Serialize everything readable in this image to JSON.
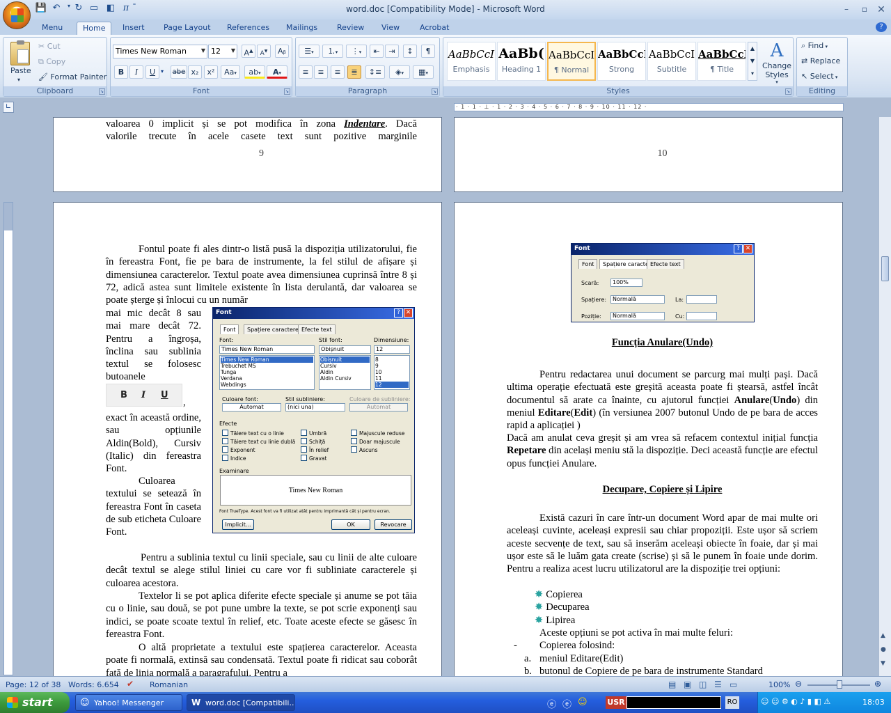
{
  "window": {
    "title": "word.doc [Compatibility Mode] - Microsoft Word"
  },
  "qat": [
    "save-icon",
    "undo-icon",
    "redo-icon",
    "repeat-icon",
    "format-painter-icon",
    "pi-icon",
    "customize-icon"
  ],
  "tabs": [
    "Menu",
    "Home",
    "Insert",
    "Page Layout",
    "References",
    "Mailings",
    "Review",
    "View",
    "Acrobat"
  ],
  "active_tab": "Home",
  "ribbon": {
    "clipboard": {
      "label": "Clipboard",
      "paste": "Paste",
      "cut": "Cut",
      "copy": "Copy",
      "format_painter": "Format Painter"
    },
    "font": {
      "label": "Font",
      "name": "Times New Roman",
      "size": "12",
      "bold": "B",
      "italic": "I",
      "underline": "U",
      "strike": "abe",
      "sub": "x₂",
      "sup": "x²",
      "case": "Aa"
    },
    "paragraph": {
      "label": "Paragraph"
    },
    "styles": {
      "label": "Styles",
      "items": [
        {
          "sample": "AaBbCcI",
          "name": "Emphasis"
        },
        {
          "sample": "AaBb(",
          "name": "Heading 1"
        },
        {
          "sample": "AaBbCcI",
          "name": "¶ Normal"
        },
        {
          "sample": "AaBbCcI",
          "name": "Strong"
        },
        {
          "sample": "AaBbCcI",
          "name": "Subtitle"
        },
        {
          "sample": "AaBbCcI",
          "name": "¶ Title"
        }
      ],
      "change": "Change Styles"
    },
    "editing": {
      "label": "Editing",
      "find": "Find",
      "replace": "Replace",
      "select": "Select"
    }
  },
  "ruler": {
    "ticks": "· 1 · 1 · ⊥ · 1 · 2 · 3 · 4 · 5 · 6 · 7 · 8 · 9 · 10 · 11 · 12 ·"
  },
  "pages": {
    "p9": {
      "line1": "valoarea 0 implicit și se pot modifica în zona ",
      "line1_bold": "Indentare",
      "line1_end": ". Dacă",
      "line2": "valorile trecute în acele casete text sunt pozitive marginile",
      "num": "9"
    },
    "p10": {
      "num": "10"
    },
    "p11": {
      "para1": "Fontul poate fi ales dintr-o listă pusă la dispoziția utilizatorului, fie în fereastra Font, fie pe bara de instrumente, la fel stilul de afișare și dimensiunea caracterelor. Textul poate avea dimensiunea cuprinsă între 8 și 72, adică astea sunt limitele existente în lista derulantă, dar valoarea se poate șterge și înlocui cu un număr",
      "col_lines": [
        "mai mic decât 8 sau",
        "mai mare decât 72.",
        "Pentru a îngroșa,",
        "înclina sau sublinia",
        "textul se folosesc",
        "butoanele"
      ],
      "comma": ",",
      "col2": "exact în această ordine, sau opțiunile Aldin(Bold), Cursiv (Italic) din fereastra Font.",
      "col3": "Culoarea textului se setează în fereastra Font în caseta de sub eticheta Culoare Font.",
      "para2": "Pentru a sublinia textul cu linii speciale, sau cu linii de alte culoare decât textul se alege stilul liniei cu care vor fi subliniate caracterele și culoarea acestora.",
      "para3": "Textelor li se pot aplica diferite efecte speciale și anume se pot tăia cu o linie, sau două, se pot pune umbre la texte, se pot scrie exponenți sau indici, se poate scoate textul în relief, etc. Toate aceste efecte se găsesc în fereastra Font.",
      "para4": "O altă proprietate a textului este spațierea caracterelor. Aceasta poate fi normală, extinsă sau condensată. Textul poate fi ridicat sau coborât față de linia normală a paragrafului. Pentru a",
      "biu": [
        "B",
        "I",
        "U"
      ]
    },
    "p12": {
      "heading1": "Funcția Anulare(Undo)",
      "p1": "Pentru redactarea unui document se parcurg mai mulți pași. Dacă ultima operație efectuată este greșită aceasta poate fi ștearsă, astfel încât documentul să arate ca înainte, cu ajutorul funcției",
      "p1_b1": "Anulare",
      "p1_b2": "Undo",
      "p1_mid": " din meniul ",
      "p1_b3": "Editare",
      "p1_b4": "Edit",
      "p1_end": " (în versiunea 2007 butonul Undo de pe bara de acces rapid a aplicației )",
      "p2a": "Dacă am anulat ceva greșit și am vrea să refacem contextul inițial funcția ",
      "p2_b": "Repetare",
      "p2b": " din același meniu stă la dispoziție. Deci această funcție are efectul opus funcției Anulare.",
      "heading2": "Decupare, Copiere și Lipire",
      "p3": "Există cazuri în care într-un document Word apar de mai multe ori aceleași cuvinte, aceleași expresii sau chiar propoziții. Este ușor să scriem aceste secvențe de text, sau să inserăm aceleași obiecte în foaie, dar și mai ușor este să le luăm gata create (scrise) și să le punem în foaie unde dorim. Pentru a realiza acest lucru utilizatorul are la dispoziție trei opțiuni:",
      "bullets": [
        "Copierea",
        "Decuparea",
        "Lipirea"
      ],
      "p4": "Aceste opțiuni se pot activa în mai multe feluri:",
      "dash": "-",
      "dash_item": "Copierea folosind:",
      "list": [
        {
          "m": "a.",
          "t": "meniul Editare(Edit)"
        },
        {
          "m": "b.",
          "t": "butonul de Copiere de pe bara de instrumente Standard"
        }
      ]
    }
  },
  "font_dialog": {
    "title": "Font",
    "tabs": [
      "Font",
      "Spațiere caractere",
      "Efecte text"
    ],
    "lbl_font": "Font:",
    "lbl_style": "Stil font:",
    "lbl_size": "Dimensiune:",
    "font_val": "Times New Roman",
    "style_val": "Obișnuit",
    "size_val": "12",
    "fonts": [
      "Times New Roman",
      "Trebuchet MS",
      "Tunga",
      "Verdana",
      "Webdings"
    ],
    "styles": [
      "Obișnuit",
      "Cursiv",
      "Aldin",
      "Aldin Cursiv"
    ],
    "sizes": [
      "8",
      "9",
      "10",
      "11",
      "12"
    ],
    "lbl_color": "Culoare font:",
    "color_val": "Automat",
    "lbl_ul": "Stil subliniere:",
    "ul_val": "(nici una)",
    "lbl_ulc": "Culoare de subliniere:",
    "ulc_val": "Automat",
    "lbl_effects": "Efecte",
    "effects": [
      "Tăiere text cu o linie",
      "Tăiere text cu linie dublă",
      "Exponent",
      "Indice",
      "Umbră",
      "Schiță",
      "În relief",
      "Gravat",
      "Majuscule reduse",
      "Doar majuscule",
      "Ascuns"
    ],
    "lbl_preview": "Examinare",
    "preview": "Times New Roman",
    "note": "Font TrueType. Acest font va fi utilizat atât pentru imprimantă cât și pentru ecran.",
    "btn_default": "Implicit...",
    "btn_ok": "OK",
    "btn_cancel": "Revocare"
  },
  "font_dialog2": {
    "title": "Font",
    "tabs": [
      "Font",
      "Spațiere caractere",
      "Efecte text"
    ],
    "scale_lbl": "Scară:",
    "scale_val": "100%",
    "spacing_lbl": "Spațiere:",
    "spacing_val": "Normală",
    "by_lbl": "La:",
    "position_lbl": "Poziție:",
    "position_val": "Normală",
    "by2_lbl": "Cu:"
  },
  "statusbar": {
    "page": "Page: 12 of 38",
    "words": "Words: 6.654",
    "lang": "Romanian",
    "zoom": "100%"
  },
  "taskbar": {
    "start": "start",
    "items": [
      "Yahoo! Messenger",
      "word.doc [Compatibili..."
    ],
    "usr": "USR",
    "ro": "RO",
    "clock": "18:03"
  }
}
